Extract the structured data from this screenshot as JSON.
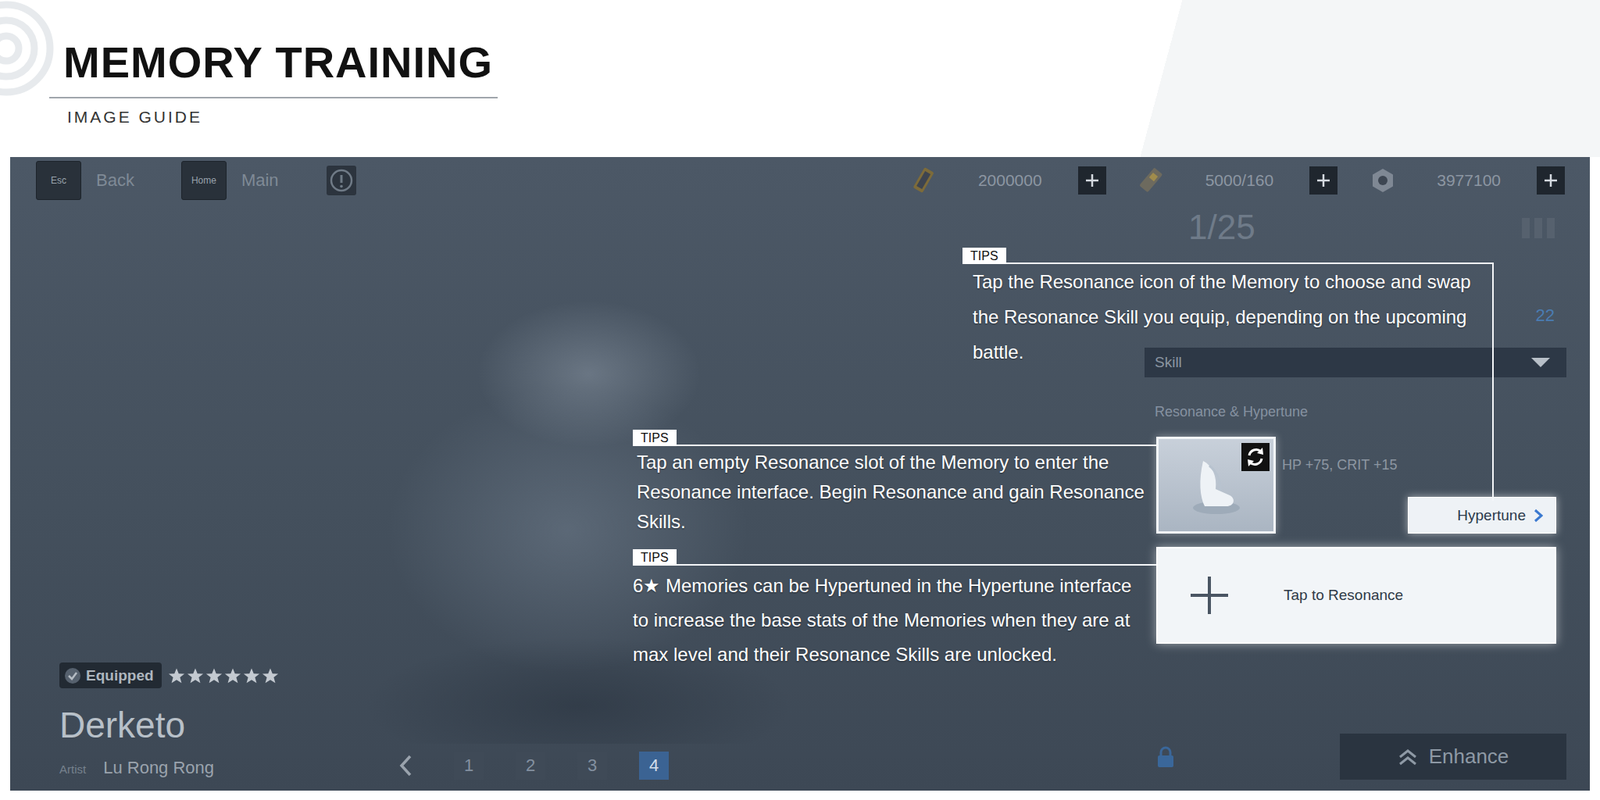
{
  "guide": {
    "title": "MEMORY TRAINING",
    "subtitle": "IMAGE GUIDE"
  },
  "nav": [
    {
      "key": "Esc",
      "label": "Back"
    },
    {
      "key": "Home",
      "label": "Main"
    }
  ],
  "resources": [
    {
      "value": "2000000"
    },
    {
      "value": "5000/160"
    },
    {
      "value": "3977100"
    }
  ],
  "memory": {
    "counter": "1/25",
    "level": "22",
    "dropdown": "Skill",
    "section": "Resonance & Hypertune",
    "skill_stats": "HP +75, CRIT +15",
    "hypertune_button": "Hypertune",
    "resonance_slot": "Tap to Resonance",
    "enhance_button": "Enhance"
  },
  "character": {
    "equipped_badge": "Equipped",
    "stars": 6,
    "name": "Derketo",
    "artist_label": "Artist",
    "artist": "Lu Rong Rong"
  },
  "pages": [
    {
      "label": "1",
      "selected": false
    },
    {
      "label": "2",
      "selected": false
    },
    {
      "label": "3",
      "selected": false
    },
    {
      "label": "4",
      "selected": true
    }
  ],
  "tips": [
    {
      "label": "TIPS",
      "text": "Tap the Resonance icon of the Memory to choose and swap the Resonance Skill you equip, depending on the upcoming battle."
    },
    {
      "label": "TIPS",
      "text": "Tap an empty Resonance slot of the Memory to enter the Resonance interface. Begin Resonance and gain Resonance Skills."
    },
    {
      "label": "TIPS",
      "text": "6★ Memories can be Hypertuned in the Hypertune interface to increase the base stats of the Memories when they are at max level and their Resonance Skills are unlocked."
    }
  ]
}
